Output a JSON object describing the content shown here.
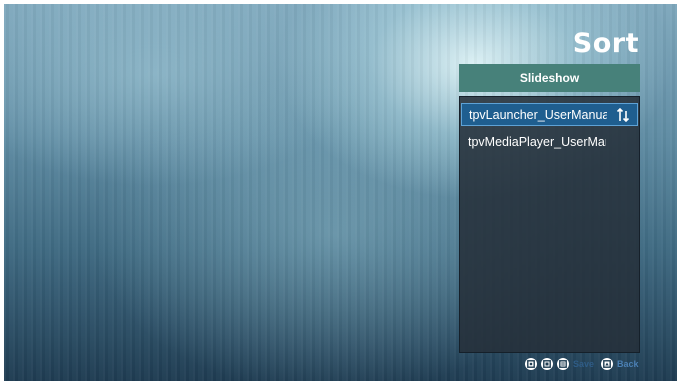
{
  "screen": {
    "title": "Sort"
  },
  "panel": {
    "header_label": "Slideshow",
    "items": [
      {
        "label": "tpvLauncher_UserManua",
        "selected": true
      },
      {
        "label": "tpvMediaPlayer_UserMar",
        "selected": false
      }
    ]
  },
  "footer": {
    "keys": [
      "key-1-icon",
      "key-2-icon",
      "key-3-icon"
    ],
    "save_label": "Save",
    "back_key": "back-key-icon",
    "back_label": "Back"
  },
  "colors": {
    "header_bg": "#47817a",
    "selected_bg": "#1f5e8f",
    "selected_border": "#5ea2d6",
    "list_bg": "#26303a"
  },
  "icons": {
    "sort": "sort-arrows-icon"
  }
}
